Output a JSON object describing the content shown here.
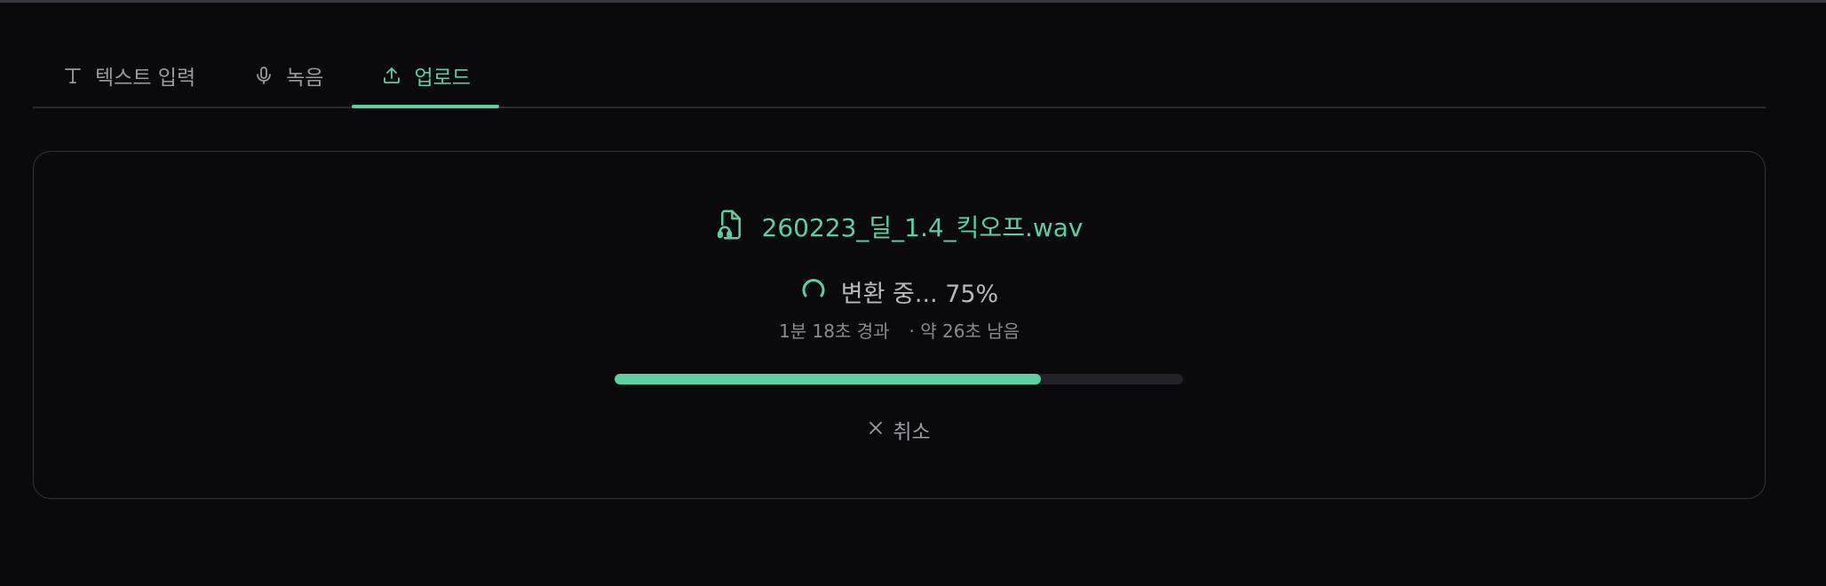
{
  "tabs": [
    {
      "label": "텍스트 입력",
      "icon": "text-icon",
      "active": false
    },
    {
      "label": "녹음",
      "icon": "microphone-icon",
      "active": false
    },
    {
      "label": "업로드",
      "icon": "upload-icon",
      "active": true
    }
  ],
  "upload": {
    "file_name": "260223_딜_1.4_킥오프.wav",
    "status_text": "변환 중... 75%",
    "progress": 0.75,
    "elapsed": "1분 18초 경과",
    "remaining": "· 약 26초 남음",
    "cancel_label": "취소"
  },
  "colors": {
    "accent": "#5ecfa2",
    "background": "#0a0a0d",
    "border": "#333338",
    "muted_text": "#9a9aa2"
  }
}
